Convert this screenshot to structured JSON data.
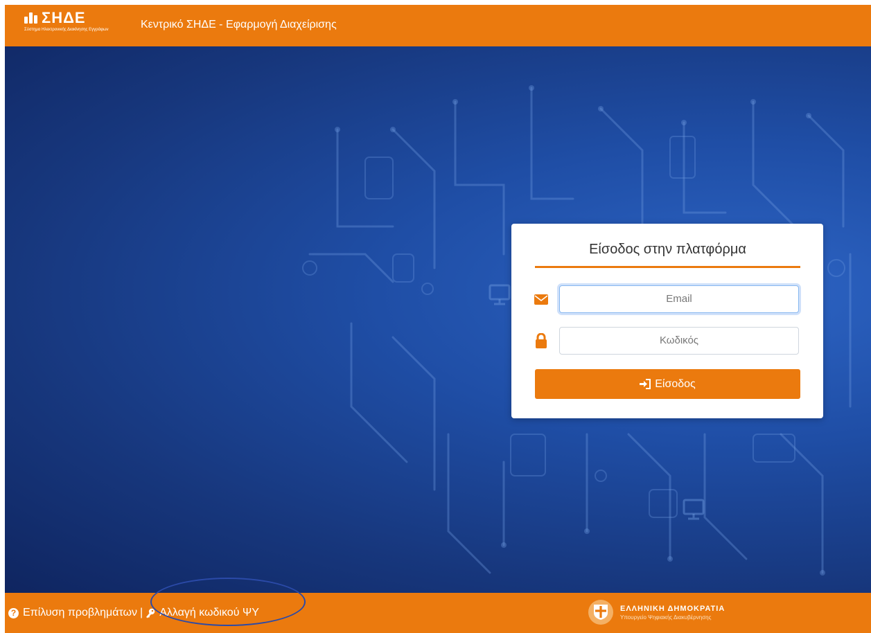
{
  "header": {
    "logo_text": "ΣΗΔΕ",
    "logo_subtitle": "Σύστημα Ηλεκτρονικής Διακίνησης Εγγράφων",
    "app_title": "Κεντρικό ΣΗΔΕ - Εφαρμογή Διαχείρισης"
  },
  "login": {
    "title": "Είσοδος στην πλατφόρμα",
    "email_placeholder": "Email",
    "password_placeholder": "Κωδικός",
    "submit_label": "Είσοδος"
  },
  "footer": {
    "help_label": "Επίλυση προβλημάτων",
    "separator": "|",
    "change_password_label": "Αλλαγή κωδικού ΨΥ",
    "gov_title": "ΕΛΛΗΝΙΚΗ ΔΗΜΟΚΡΑΤΙΑ",
    "gov_subtitle": "Υπουργείο Ψηφιακής Διακυβέρνησης"
  },
  "colors": {
    "accent": "#eb7a0e",
    "background_blue": "#1a3f8a",
    "annotation_oval": "#2b4aa8"
  },
  "icons": {
    "email": "envelope-icon",
    "password": "lock-icon",
    "submit": "sign-in-icon",
    "help": "question-circle-icon",
    "change_password": "key-icon"
  }
}
